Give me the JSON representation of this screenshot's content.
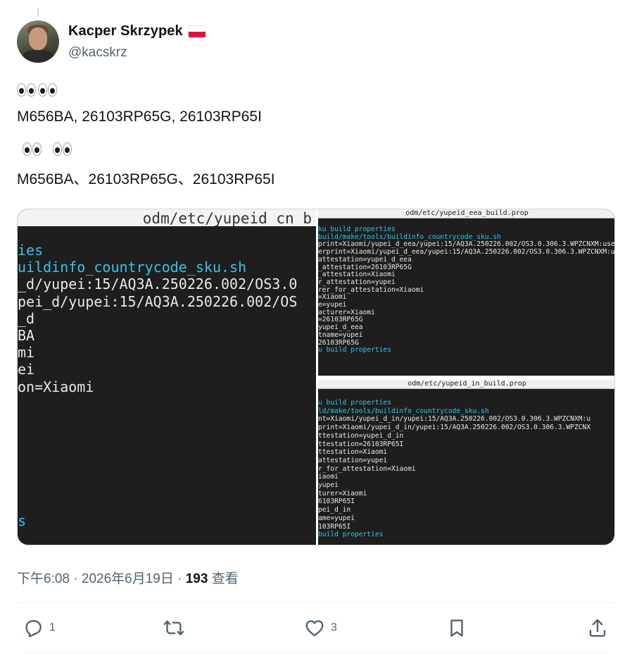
{
  "author": {
    "display_name": "Kacper Skrzypek",
    "handle": "@kacskrz",
    "flag_icon": "poland-flag-icon"
  },
  "tweet": {
    "line1_emoji": "👀👀",
    "line2": "M656BA, 26103RP65G, 26103RP65I",
    "line3_emoji": "👀 👀",
    "line4": "M656BA、26103RP65G、26103RP65I"
  },
  "media": {
    "left": {
      "title": "odm/etc/yupeid_cn_b",
      "lines": [
        {
          "text": "ies",
          "color": "cyan"
        },
        {
          "text": "uildinfo_countrycode_sku.sh",
          "color": "cyan"
        },
        {
          "text": "_d/yupei:15/AQ3A.250226.002/OS3.0",
          "color": "white"
        },
        {
          "text": "pei_d/yupei:15/AQ3A.250226.002/OS",
          "color": "white"
        },
        {
          "text": "_d",
          "color": "white"
        },
        {
          "text": "BA",
          "color": "white"
        },
        {
          "text": "mi",
          "color": "white"
        },
        {
          "text": "ei",
          "color": "white"
        },
        {
          "text": "on=Xiaomi",
          "color": "white"
        }
      ],
      "bottom": "s"
    },
    "top_right": {
      "title": "odm/etc/yupeid_eea_build.prop",
      "lines": [
        {
          "text": "ku build properties",
          "color": "cyan"
        },
        {
          "text": "build/make/tools/buildinfo_countrycode_sku.sh",
          "color": "cyan"
        },
        {
          "text": "print=Xiaomi/yupei_d_eea/yupei:15/AQ3A.250226.002/OS3.0.306.3.WPZCNXM:user",
          "color": "white"
        },
        {
          "text": "erprint=Xiaomi/yupei_d_eea/yupei:15/AQ3A.250226.002/OS3.0.306.3.WPZCNXM:u",
          "color": "white"
        },
        {
          "text": "attestation=yupei_d_eea",
          "color": "white"
        },
        {
          "text": "_attestation=26103RP65G",
          "color": "white"
        },
        {
          "text": "_attestation=Xiaomi",
          "color": "white"
        },
        {
          "text": "r_attestation=yupei",
          "color": "white"
        },
        {
          "text": "rer_for_attestation=Xiaomi",
          "color": "white"
        },
        {
          "text": "=Xiaomi",
          "color": "white"
        },
        {
          "text": "e=yupei",
          "color": "white"
        },
        {
          "text": "acturer=Xiaomi",
          "color": "white"
        },
        {
          "text": "=26103RP65G",
          "color": "white"
        },
        {
          "text": "yupei_d_eea",
          "color": "white"
        },
        {
          "text": "tname=yupei",
          "color": "white"
        },
        {
          "text": "26103RP65G",
          "color": "white"
        },
        {
          "text": "u build properties",
          "color": "cyan"
        }
      ]
    },
    "bottom_right": {
      "title": "odm/etc/yupeid_in_build.prop",
      "lines": [
        {
          "text": "u build properties",
          "color": "cyan"
        },
        {
          "text": "ld/make/tools/buildinfo_countrycode_sku.sh",
          "color": "cyan"
        },
        {
          "text": "nt=Xiaomi/yupei_d_in/yupei:15/AQ3A.250226.002/OS3.0.306.3.WPZCNXM:u",
          "color": "white"
        },
        {
          "text": "print=Xiaomi/yupei_d_in/yupei:15/AQ3A.250226.002/OS3.0.306.3.WPZCNX",
          "color": "white"
        },
        {
          "text": "ttestation=yupei_d_in",
          "color": "white"
        },
        {
          "text": "ttestation=26103RP65I",
          "color": "white"
        },
        {
          "text": "ttestation=Xiaomi",
          "color": "white"
        },
        {
          "text": "attestation=yupei",
          "color": "white"
        },
        {
          "text": "r_for_attestation=Xiaomi",
          "color": "white"
        },
        {
          "text": "iaomi",
          "color": "white"
        },
        {
          "text": "yupei",
          "color": "white"
        },
        {
          "text": "turer=Xiaomi",
          "color": "white"
        },
        {
          "text": "6103RP65I",
          "color": "white"
        },
        {
          "text": "pei_d_in",
          "color": "white"
        },
        {
          "text": "ame=yupei",
          "color": "white"
        },
        {
          "text": "103RP65I",
          "color": "white"
        },
        {
          "text": "build properties",
          "color": "cyan"
        }
      ]
    }
  },
  "meta": {
    "time": "下午6:08",
    "dot1": "·",
    "date": "2026年6月19日",
    "dot2": "·",
    "views_count": "193",
    "views_label": "查看"
  },
  "actions": {
    "reply_count": "1",
    "retweet_count": "",
    "like_count": "3",
    "icons": [
      "reply-icon",
      "retweet-icon",
      "like-icon",
      "bookmark-icon",
      "share-icon"
    ]
  },
  "colors": {
    "terminal_bg": "#1e1e1e",
    "terminal_cyan": "#34c6e8",
    "text_secondary": "#536471"
  }
}
